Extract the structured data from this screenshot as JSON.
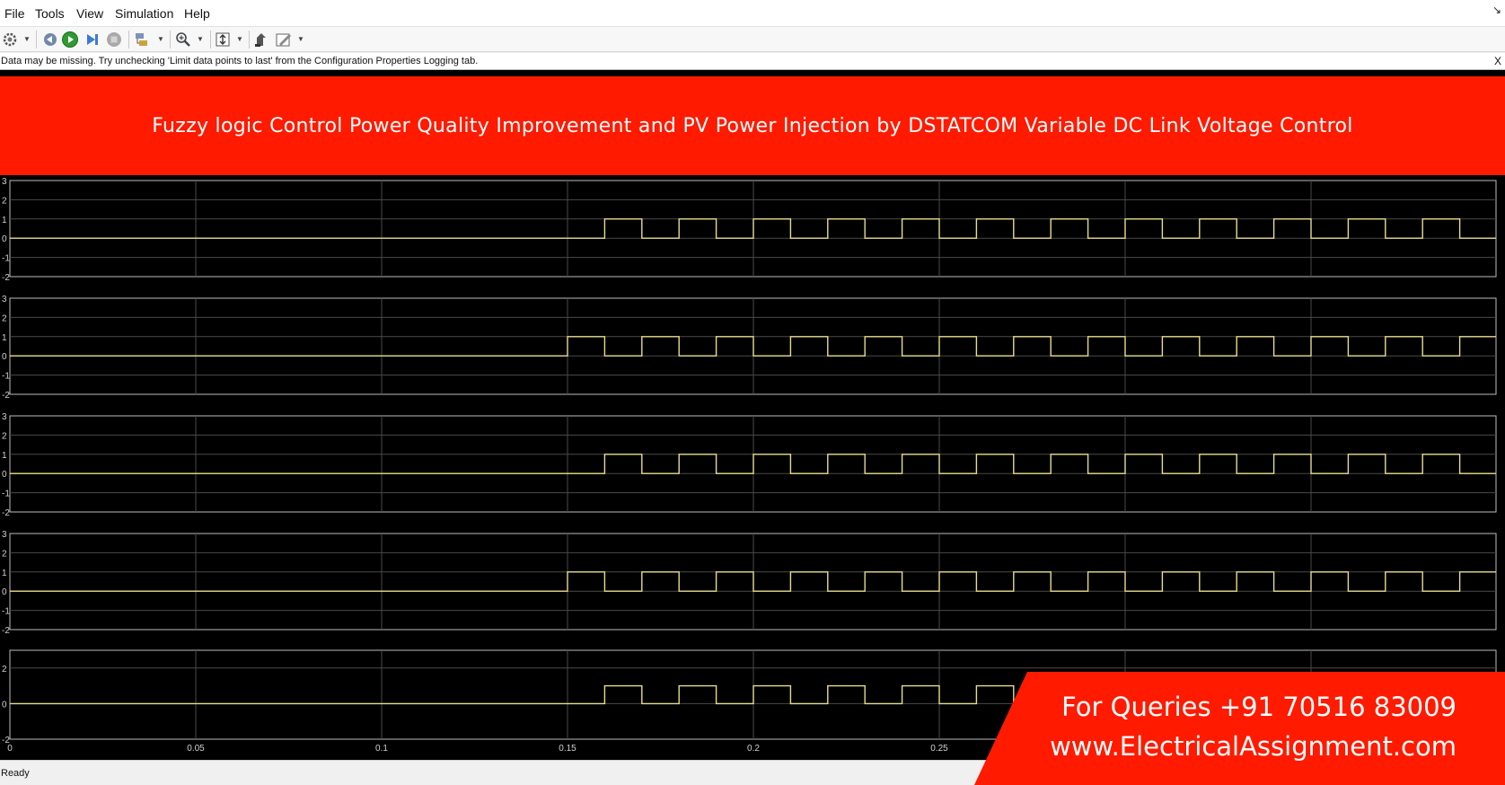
{
  "menubar": {
    "items": [
      {
        "label": "File"
      },
      {
        "label": "Tools"
      },
      {
        "label": "View"
      },
      {
        "label": "Simulation"
      },
      {
        "label": "Help"
      }
    ]
  },
  "toolbar": {
    "icons": [
      "gear-icon",
      "step-back-icon",
      "run-icon",
      "step-forward-icon",
      "stop-icon",
      "signal-select-icon",
      "zoom-icon",
      "autoscale-icon",
      "highlight-icon",
      "style-icon"
    ]
  },
  "infobar": {
    "message": "Data may be missing.  Try unchecking 'Limit data points to last' from the Configuration Properties Logging tab.",
    "close_label": "X"
  },
  "banner": {
    "title": "Fuzzy logic Control Power Quality Improvement and PV Power Injection by DSTATCOM Variable DC Link Voltage Control",
    "color": "#ff1a00"
  },
  "queries": {
    "phone": "For Queries +91 70516 83009",
    "website": "www.ElectricalAssignment.com"
  },
  "status": {
    "text": "Ready"
  },
  "colors": {
    "plot_background": "#000000",
    "grid": "#4a4a4a",
    "trace": "#e8dd8c",
    "axes_text": "#d0d0d0"
  },
  "chart_data": [
    {
      "type": "line",
      "y_ticks": [
        "3",
        "2",
        "1",
        "0",
        "-1",
        "-2"
      ],
      "ylim": [
        -2,
        3
      ],
      "xlim": [
        0,
        0.4
      ],
      "series": [
        {
          "start_time": 0.15,
          "period": 0.01,
          "first_level": 0,
          "levels": [
            0,
            1
          ]
        }
      ]
    },
    {
      "type": "line",
      "y_ticks": [
        "3",
        "2",
        "1",
        "0",
        "-1",
        "-2"
      ],
      "ylim": [
        -2,
        3
      ],
      "xlim": [
        0,
        0.4
      ],
      "series": [
        {
          "start_time": 0.15,
          "period": 0.01,
          "first_level": 1,
          "levels": [
            0,
            1
          ]
        }
      ]
    },
    {
      "type": "line",
      "y_ticks": [
        "3",
        "2",
        "1",
        "0",
        "-1",
        "-2"
      ],
      "ylim": [
        -2,
        3
      ],
      "xlim": [
        0,
        0.4
      ],
      "series": [
        {
          "start_time": 0.15,
          "period": 0.01,
          "first_level": 0,
          "levels": [
            0,
            1
          ]
        }
      ]
    },
    {
      "type": "line",
      "y_ticks": [
        "3",
        "2",
        "1",
        "0",
        "-1",
        "-2"
      ],
      "ylim": [
        -2,
        3
      ],
      "xlim": [
        0,
        0.4
      ],
      "series": [
        {
          "start_time": 0.15,
          "period": 0.01,
          "first_level": 1,
          "levels": [
            0,
            1
          ]
        }
      ]
    },
    {
      "type": "line",
      "y_ticks": [
        "2",
        "0",
        "-2"
      ],
      "ylim": [
        -2,
        3
      ],
      "xlim": [
        0,
        0.4
      ],
      "x_ticks": [
        "0",
        "0.05",
        "0.1",
        "0.15",
        "0.2",
        "0.25"
      ],
      "series": [
        {
          "start_time": 0.15,
          "period": 0.01,
          "first_level": 0,
          "levels": [
            0,
            1
          ]
        }
      ]
    }
  ]
}
